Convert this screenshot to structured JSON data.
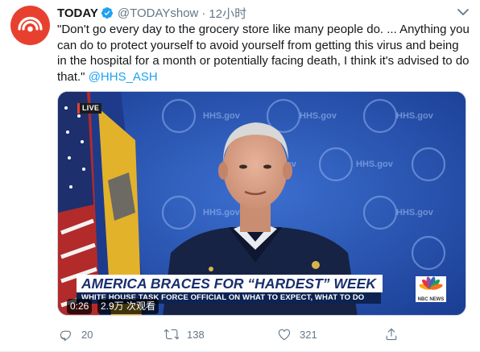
{
  "account": {
    "display_name": "TODAY",
    "handle": "@TODAYshow",
    "separator": "·",
    "time": "12小时",
    "avatar_icon": "peacock-sunrise-logo-icon"
  },
  "tweet": {
    "text": "\"Don't go every day to the grocery store like many people do. ... Anything you can do to protect yourself to avoid yourself from getting this virus and being in the hospital for a month or potentially facing death, I think it's advised to do that.\" ",
    "mention": "@HHS_ASH"
  },
  "media": {
    "live_label": "LIVE",
    "chyron_main": "AMERICA BRACES FOR “HARDEST” WEEK",
    "chyron_sub": "WHITE HOUSE TASK FORCE OFFICIAL ON WHAT TO EXPECT, WHAT TO DO",
    "backdrop_text": "HHS.gov",
    "nbc_label": "NBC NEWS",
    "duration": "0:26",
    "views": "2.9万 次观看"
  },
  "actions": {
    "replies": "20",
    "retweets": "138",
    "likes": "321"
  },
  "colors": {
    "accent": "#1da1f2",
    "muted": "#657786",
    "avatar_bg": "#e8402f",
    "backdrop_blue": "#1f4fae",
    "chyron_navy": "#0d2352"
  }
}
